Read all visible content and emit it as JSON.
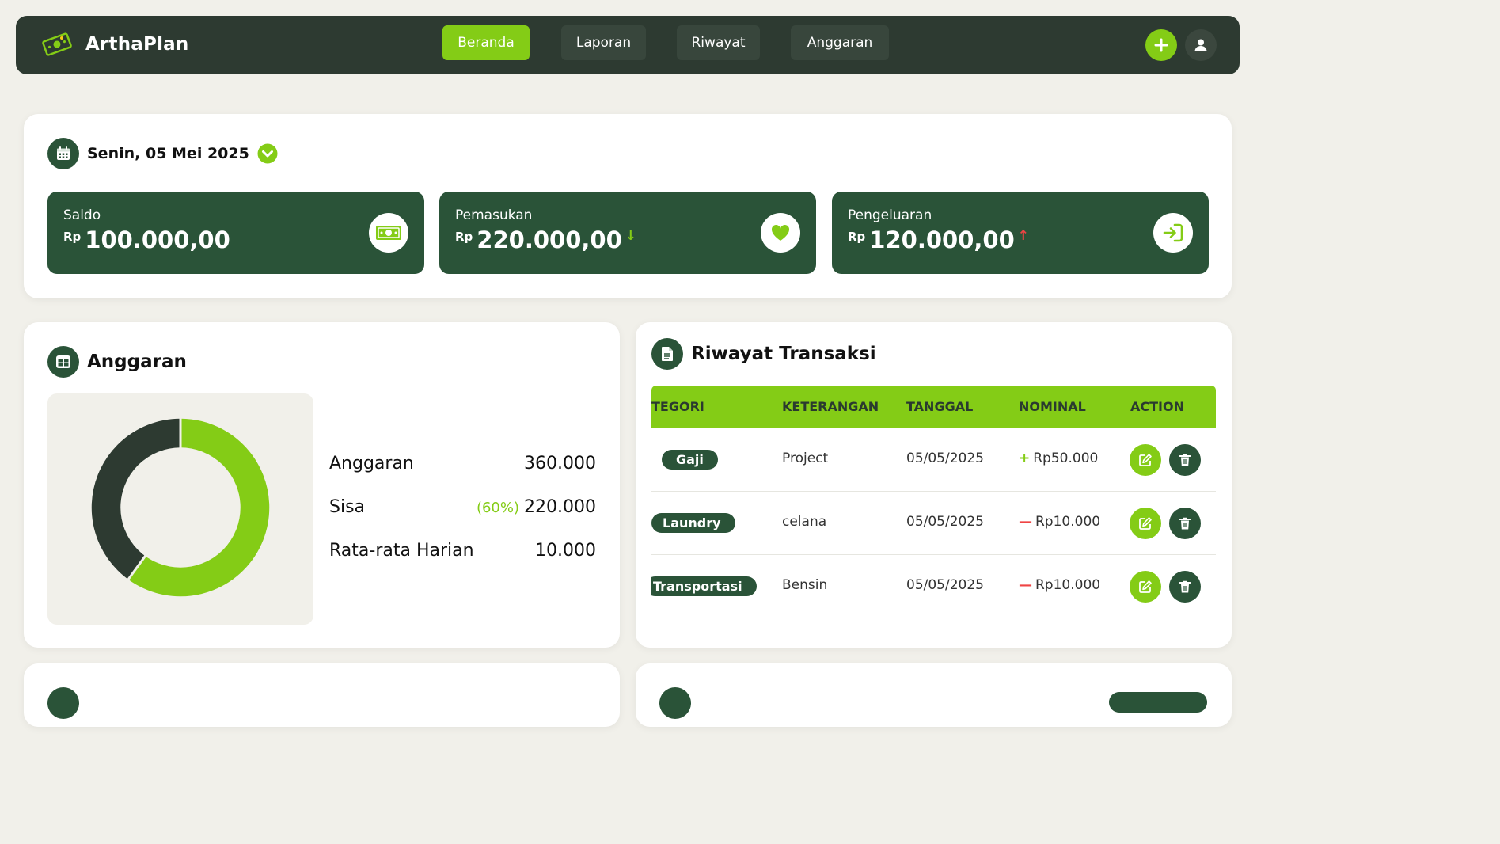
{
  "app": {
    "name": "ArthaPlan"
  },
  "nav": {
    "tabs": [
      {
        "label": "Beranda",
        "active": true
      },
      {
        "label": "Laporan",
        "active": false
      },
      {
        "label": "Riwayat",
        "active": false
      },
      {
        "label": "Anggaran",
        "active": false
      }
    ],
    "add_icon": "plus-icon",
    "profile_icon": "user-icon"
  },
  "summary": {
    "date": "Senin, 05 Mei 2025",
    "cards": [
      {
        "label": "Saldo",
        "currency": "Rp",
        "value": "100.000,00",
        "icon": "money-icon"
      },
      {
        "label": "Pemasukan",
        "currency": "Rp",
        "value": "220.000,00",
        "arrow": "↓",
        "arrow_color": "#84cc16",
        "icon": "heart-icon"
      },
      {
        "label": "Pengeluaran",
        "currency": "Rp",
        "value": "120.000,00",
        "arrow": "↑",
        "arrow_color": "#ef4444",
        "icon": "sign-in-icon"
      }
    ]
  },
  "budget": {
    "title": "Anggaran",
    "used_fraction": 0.6,
    "rows": [
      {
        "label": "Anggaran",
        "value": "360.000",
        "pct": ""
      },
      {
        "label": "Sisa",
        "value": "220.000",
        "pct": "(60%)"
      },
      {
        "label": "Rata-rata Harian",
        "value": "10.000",
        "pct": ""
      }
    ],
    "colors": {
      "primary": "#84cc16",
      "secondary": "#2d3a31"
    }
  },
  "transactions": {
    "title": "Riwayat Transaksi",
    "columns": [
      "TEGORI",
      "KETERANGAN",
      "TANGGAL",
      "NOMINAL",
      "ACTION"
    ],
    "rows": [
      {
        "category": "Gaji",
        "description": "Project",
        "date": "05/05/2025",
        "sign": "+",
        "amount": "Rp50.000"
      },
      {
        "category": "Laundry",
        "description": "celana",
        "date": "05/05/2025",
        "sign": "—",
        "amount": "Rp10.000"
      },
      {
        "category": "Transportasi",
        "description": "Bensin",
        "date": "05/05/2025",
        "sign": "—",
        "amount": "Rp10.000"
      }
    ]
  },
  "colors": {
    "accent": "#84cc16",
    "dark": "#2a5338",
    "navbar": "#2d3a31",
    "expense": "#ef4444"
  }
}
